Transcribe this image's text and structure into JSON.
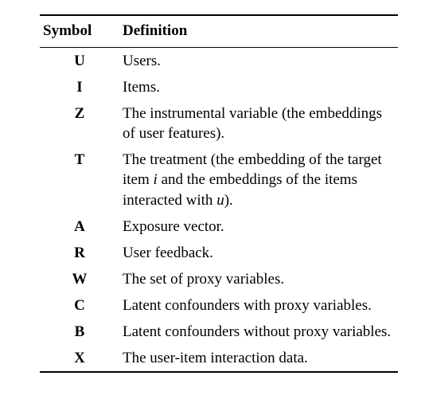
{
  "headers": {
    "symbol": "Symbol",
    "definition": "Definition"
  },
  "rows": [
    {
      "symbol": "U",
      "definition": "Users."
    },
    {
      "symbol": "I",
      "definition": "Items."
    },
    {
      "symbol": "Z",
      "definition": "The instrumental variable (the embeddings of user features)."
    },
    {
      "symbol": "T",
      "definition_parts": [
        "The treatment (the embedding of the target item ",
        "i",
        " and the embeddings of the items interacted with ",
        "u",
        ")."
      ]
    },
    {
      "symbol": "A",
      "definition": "Exposure vector."
    },
    {
      "symbol": "R",
      "definition": "User feedback."
    },
    {
      "symbol": "W",
      "definition": "The set of proxy variables."
    },
    {
      "symbol": "C",
      "definition": "Latent confounders with proxy variables."
    },
    {
      "symbol": "B",
      "definition": "Latent confounders without proxy variables."
    },
    {
      "symbol": "X",
      "definition": "The user-item interaction data."
    }
  ]
}
